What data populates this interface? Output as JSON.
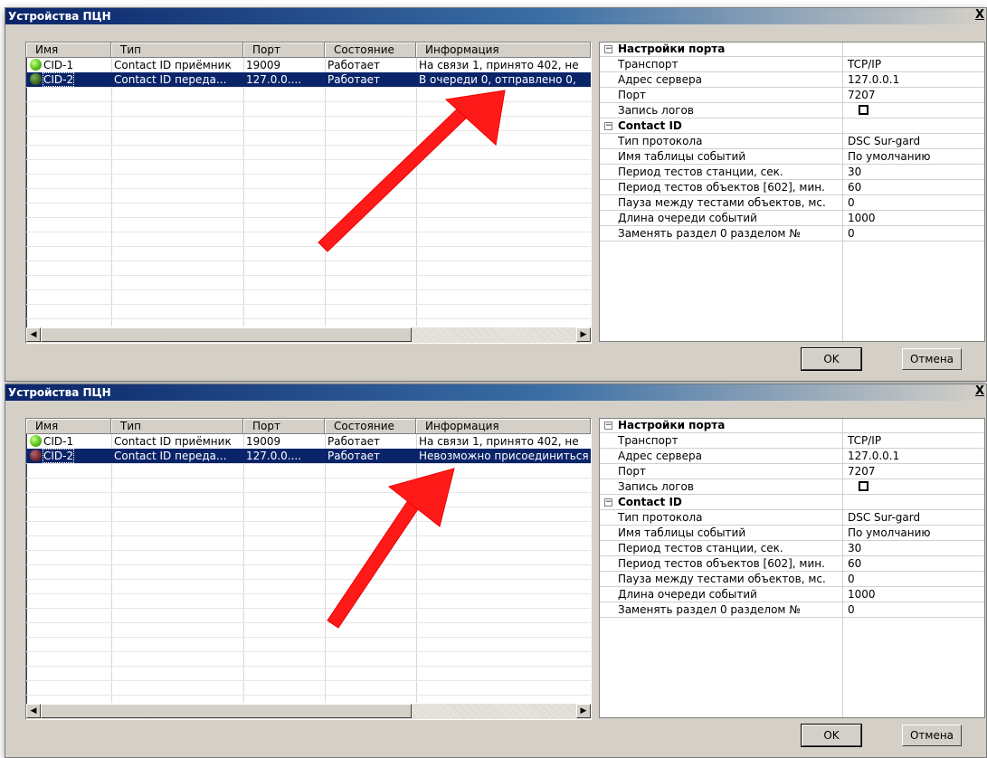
{
  "dialogs": [
    {
      "title": "Устройства ПЦН",
      "close_label": "X",
      "columns": [
        "Имя",
        "Тип",
        "Порт",
        "Состояние",
        "Информация"
      ],
      "rows": [
        {
          "name": "CID-1",
          "type": "Contact ID приёмник",
          "port": "19009",
          "state": "Работает",
          "info": "На связи 1, принято 402, не",
          "led": "green-led-icon",
          "selected": false
        },
        {
          "name": "CID-2",
          "type": "Contact ID переда...",
          "port": "127.0.0....",
          "state": "Работает",
          "info": "В очереди 0, отправлено 0,",
          "led": "dark-green-led-icon",
          "selected": true
        }
      ],
      "props": [
        {
          "kind": "category",
          "name": "Настройки порта",
          "value": ""
        },
        {
          "kind": "item",
          "name": "Транспорт",
          "value": "TCP/IP"
        },
        {
          "kind": "item",
          "name": "Адрес сервера",
          "value": "127.0.0.1"
        },
        {
          "kind": "item",
          "name": "Порт",
          "value": "7207"
        },
        {
          "kind": "checkbox",
          "name": "Запись логов",
          "value": ""
        },
        {
          "kind": "category",
          "name": "Contact ID",
          "value": ""
        },
        {
          "kind": "item",
          "name": "Тип протокола",
          "value": "DSC Sur-gard"
        },
        {
          "kind": "item",
          "name": "Имя таблицы событий",
          "value": "По умолчанию"
        },
        {
          "kind": "item",
          "name": "Период тестов станции, сек.",
          "value": "30"
        },
        {
          "kind": "item",
          "name": "Период тестов объектов [602], мин.",
          "value": "60"
        },
        {
          "kind": "item",
          "name": "Пауза между тестами объектов, мс.",
          "value": "0"
        },
        {
          "kind": "item",
          "name": "Длина очереди событий",
          "value": "1000"
        },
        {
          "kind": "item",
          "name": "Заменять раздел 0 разделом №",
          "value": "0"
        }
      ],
      "ok_label": "OK",
      "cancel_label": "Отмена"
    },
    {
      "title": "Устройства ПЦН",
      "close_label": "X",
      "columns": [
        "Имя",
        "Тип",
        "Порт",
        "Состояние",
        "Информация"
      ],
      "rows": [
        {
          "name": "CID-1",
          "type": "Contact ID приёмник",
          "port": "19009",
          "state": "Работает",
          "info": "На связи 1, принято 402, не",
          "led": "green-led-icon",
          "selected": false
        },
        {
          "name": "CID-2",
          "type": "Contact ID переда...",
          "port": "127.0.0....",
          "state": "Работает",
          "info": "Невозможно присоединиться",
          "led": "dark-red-led-icon",
          "selected": true
        }
      ],
      "props": [
        {
          "kind": "category",
          "name": "Настройки порта",
          "value": ""
        },
        {
          "kind": "item",
          "name": "Транспорт",
          "value": "TCP/IP"
        },
        {
          "kind": "item",
          "name": "Адрес сервера",
          "value": "127.0.0.1"
        },
        {
          "kind": "item",
          "name": "Порт",
          "value": "7207"
        },
        {
          "kind": "checkbox",
          "name": "Запись логов",
          "value": ""
        },
        {
          "kind": "category",
          "name": "Contact ID",
          "value": ""
        },
        {
          "kind": "item",
          "name": "Тип протокола",
          "value": "DSC Sur-gard"
        },
        {
          "kind": "item",
          "name": "Имя таблицы событий",
          "value": "По умолчанию"
        },
        {
          "kind": "item",
          "name": "Период тестов станции, сек.",
          "value": "30"
        },
        {
          "kind": "item",
          "name": "Период тестов объектов [602], мин.",
          "value": "60"
        },
        {
          "kind": "item",
          "name": "Пауза между тестами объектов, мс.",
          "value": "0"
        },
        {
          "kind": "item",
          "name": "Длина очереди событий",
          "value": "1000"
        },
        {
          "kind": "item",
          "name": "Заменять раздел 0 разделом №",
          "value": "0"
        }
      ],
      "ok_label": "OK",
      "cancel_label": "Отмена"
    }
  ],
  "colors": {
    "selection": "#0a246a",
    "annotation_arrow": "#ff1a1a",
    "window_bg": "#d4d0c8"
  }
}
